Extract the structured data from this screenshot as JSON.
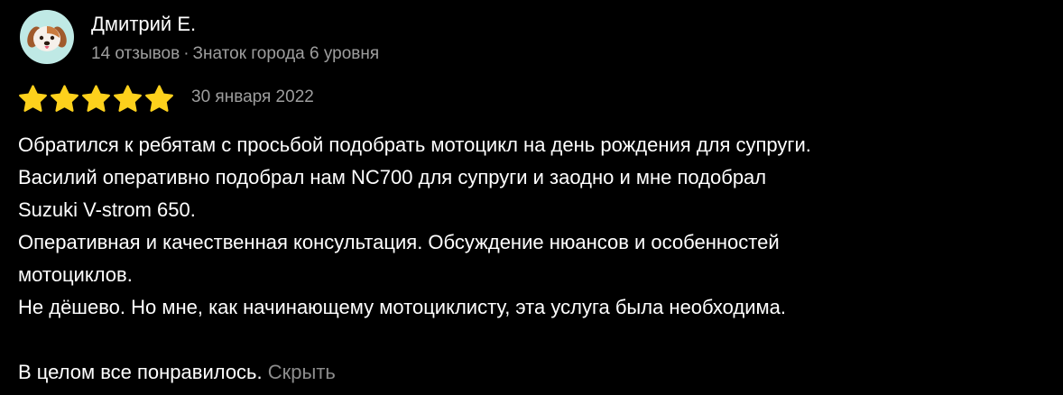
{
  "author": {
    "name": "Дмитрий Е.",
    "reviews_count": "14 отзывов",
    "separator": "·",
    "level": "Знаток города 6 уровня",
    "avatar_icon": "dog-avatar-icon"
  },
  "rating": {
    "value": 5,
    "max": 5,
    "star_color": "#fdd11c"
  },
  "date": "30 января 2022",
  "body": {
    "lines": [
      "Обратился к ребятам с просьбой подобрать мотоцикл на день рождения для супруги.",
      "Василий оперативно подобрал нам NC700 для супруги и заодно и мне подобрал",
      "Suzuki V-strom 650.",
      "Оперативная и качественная консультация. Обсуждение нюансов и особенностей",
      "мотоциклов.",
      "Не дёшево. Но мне, как начинающему мотоциклисту, эта услуга была необходима."
    ],
    "final_line": "В целом все понравилось.",
    "hide_label": "Скрыть"
  },
  "colors": {
    "background": "#000000",
    "text": "#ffffff",
    "muted": "#9e9e9e",
    "link": "#8c8c8c",
    "avatar_bg": "#bfe9e5"
  }
}
